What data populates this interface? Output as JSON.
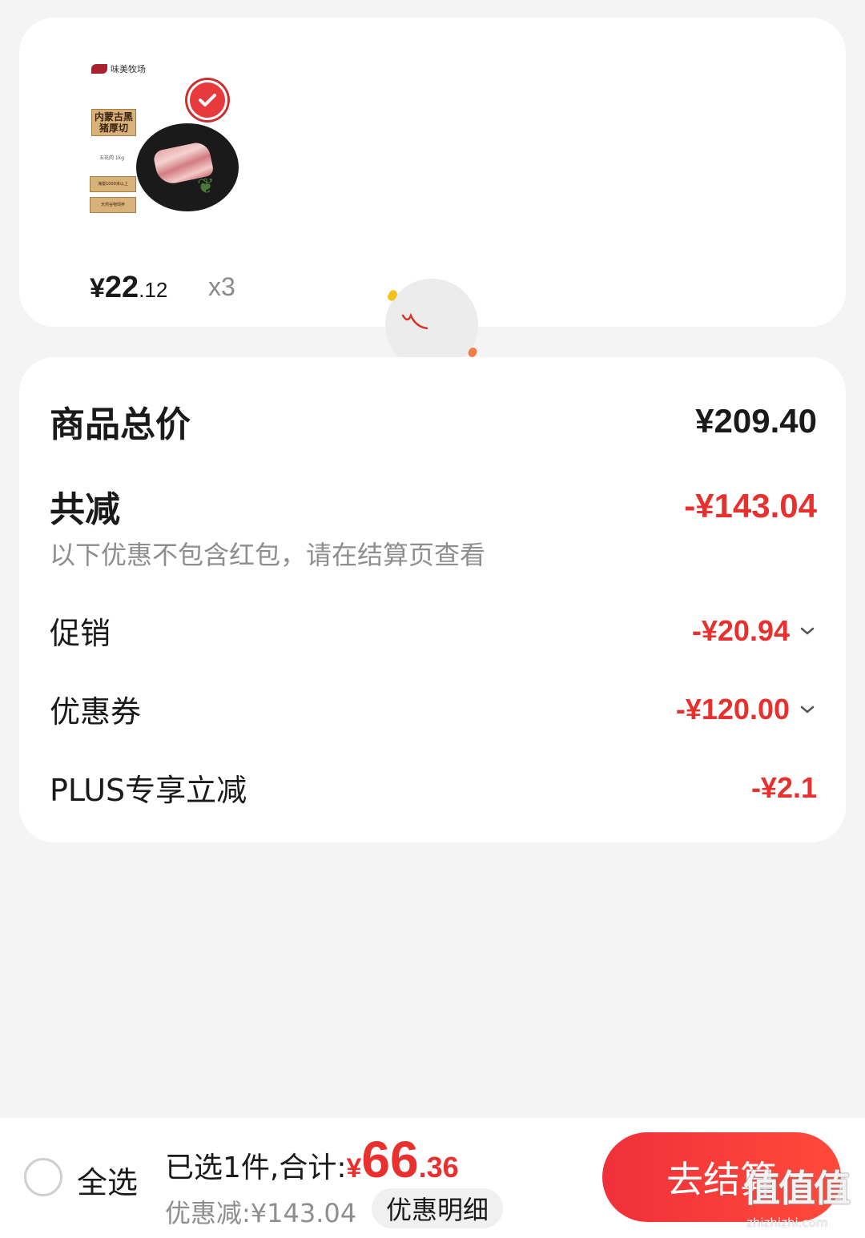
{
  "product": {
    "brand_name": "味美牧场",
    "pack_title": "内蒙古黑猪厚切",
    "pack_subtitle": "五花肉 1kg",
    "pack_tag_1": "海拔1000米以上",
    "pack_tag_2": "天然谷物饲养",
    "price_symbol": "¥",
    "price_int": "22",
    "price_dec": ".12",
    "quantity": "x3"
  },
  "summary": {
    "total_label": "商品总价",
    "total_value": "¥209.40",
    "reduce_label": "共减",
    "reduce_value": "-¥143.04",
    "note": "以下优惠不包含红包，请在结算页查看",
    "items": [
      {
        "label": "促销",
        "value": "-¥20.94",
        "expandable": true
      },
      {
        "label": "优惠券",
        "value": "-¥120.00",
        "expandable": true
      },
      {
        "label": "PLUS专享立减",
        "value": "-¥2.1",
        "expandable": false
      }
    ]
  },
  "bottom_bar": {
    "select_all": "全选",
    "selected_text": "已选1件,合计:",
    "total_symbol": "¥",
    "total_int": "66",
    "total_dec": ".36",
    "saved_text": "优惠减:¥143.04",
    "detail_chip": "优惠明细",
    "checkout": "去结算"
  },
  "watermark": {
    "text": "值值值",
    "url": "zhizhizhi.com"
  },
  "colors": {
    "accent_red": "#e8312f",
    "background": "#f4f4f4",
    "card": "#ffffff"
  },
  "icons": [
    "check-badge-icon",
    "loading-icon",
    "chevron-down-icon",
    "radio-icon"
  ]
}
